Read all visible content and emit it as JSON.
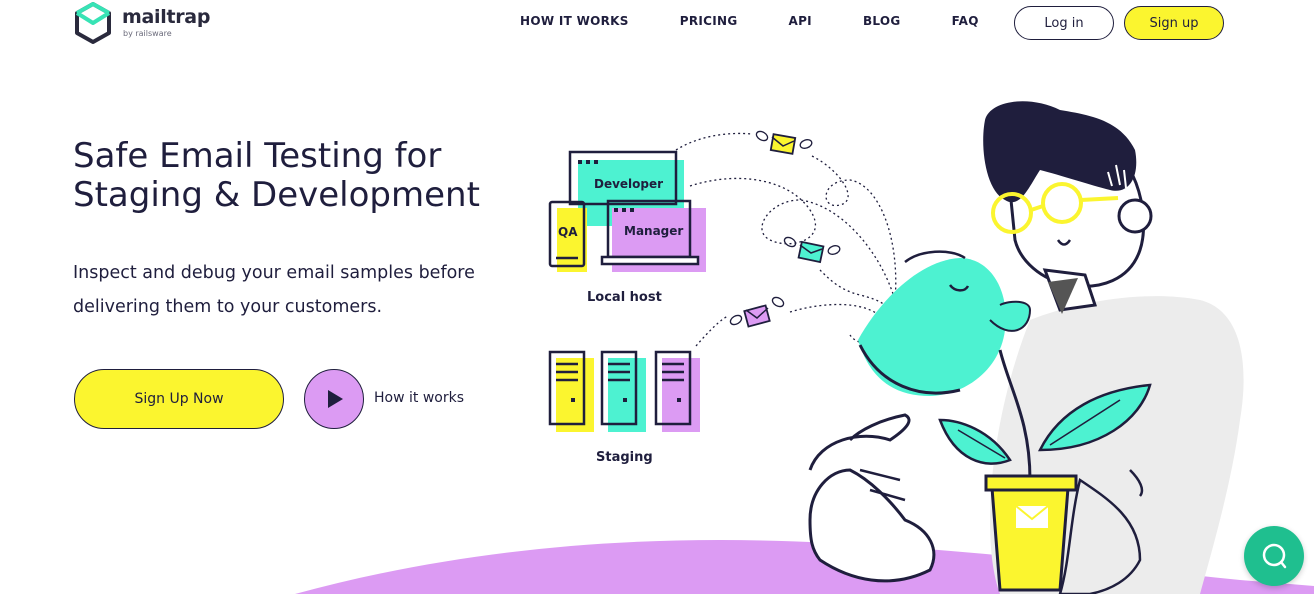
{
  "brand": {
    "name": "mailtrap",
    "sub": "by railsware",
    "accent_yellow": "#fbf52f",
    "accent_teal": "#4df2d1",
    "accent_purple": "#dc9bf3",
    "ink": "#1f1e3d"
  },
  "nav": {
    "items": [
      {
        "label": "HOW IT WORKS"
      },
      {
        "label": "PRICING"
      },
      {
        "label": "API"
      },
      {
        "label": "BLOG"
      },
      {
        "label": "FAQ"
      }
    ],
    "login_label": "Log in",
    "signup_label": "Sign up"
  },
  "hero": {
    "title_line1": "Safe Email Testing for",
    "title_line2": "Staging & Development",
    "subtitle_line1": "Inspect and debug your email samples before",
    "subtitle_line2": "delivering them to your customers.",
    "cta_label": "Sign Up Now",
    "how_label": "How it works"
  },
  "illustration": {
    "developer_label": "Developer",
    "qa_label": "QA",
    "manager_label": "Manager",
    "localhost_label": "Local host",
    "staging_label": "Staging"
  },
  "icons": {
    "logo": "mailtrap-logo-icon",
    "play": "play-icon",
    "chat": "chat-icon"
  }
}
